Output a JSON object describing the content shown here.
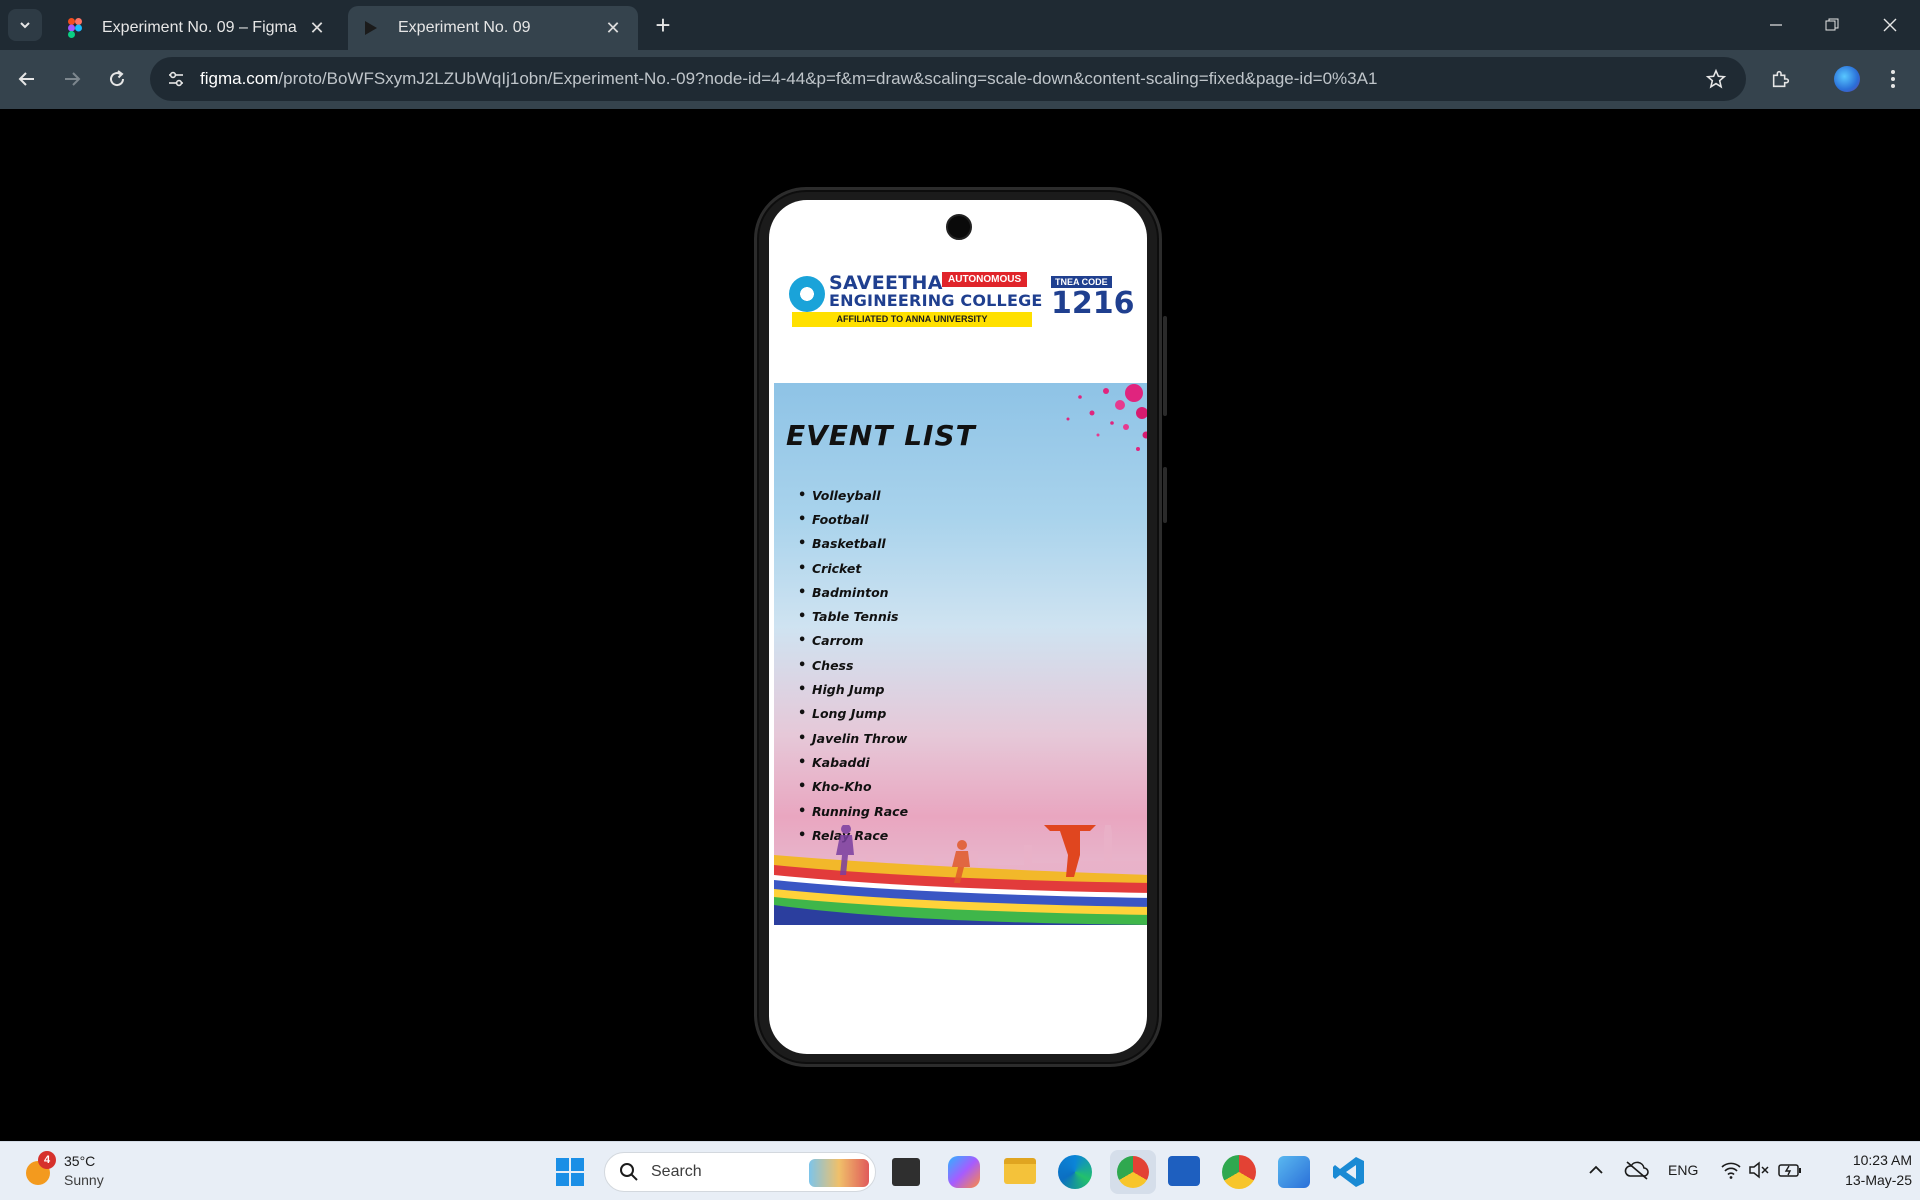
{
  "browser": {
    "tabs": [
      {
        "title": "Experiment No. 09 – Figma",
        "icon": "figma-icon",
        "active": false
      },
      {
        "title": "Experiment No. 09",
        "icon": "play-icon",
        "active": true
      }
    ],
    "url_host": "figma.com",
    "url_path": "/proto/BoWFSxymJ2LZUbWqIj1obn/Experiment-No.-09?node-id=4-44&p=f&m=draw&scaling=scale-down&content-scaling=fixed&page-id=0%3A1"
  },
  "logo": {
    "line1": "SAVEETHA",
    "line2": "ENGINEERING COLLEGE",
    "badge": "AUTONOMOUS",
    "affiliation": "AFFILIATED TO ANNA UNIVERSITY",
    "tnea_label": "TNEA CODE",
    "tnea_code": "1216"
  },
  "poster": {
    "title": "EVENT  LIST",
    "events": [
      "Volleyball",
      "Football",
      "Basketball",
      "Cricket",
      "Badminton",
      "Table Tennis",
      "Carrom",
      "Chess",
      "High Jump",
      "Long Jump",
      "Javelin Throw",
      "Kabaddi",
      "Kho-Kho",
      "Running Race",
      "Relay Race"
    ]
  },
  "taskbar": {
    "weather_temp": "35°C",
    "weather_desc": "Sunny",
    "weather_badge": "4",
    "search_placeholder": "Search",
    "language": "ENG",
    "time": "10:23 AM",
    "date": "13-May-25"
  },
  "colors": {
    "chrome_dark": "#1f2a33",
    "chrome_toolbar": "#35434d",
    "college_blue": "#1f3f8f",
    "badge_red": "#e0242a",
    "affiliation_yellow": "#ffe000"
  }
}
